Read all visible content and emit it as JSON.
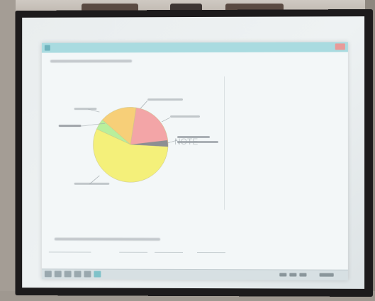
{
  "scene": {
    "description_tags": [
      "projector-screen",
      "slide-display"
    ]
  },
  "screen": {
    "window": {
      "title": "",
      "close_label": ""
    },
    "chart": {
      "type": "pie",
      "segments": [
        {
          "name": "yellow",
          "color": "#f4f07a"
        },
        {
          "name": "green",
          "color": "#b8ef9c"
        },
        {
          "name": "orange",
          "color": "#f7cf78"
        },
        {
          "name": "pink",
          "color": "#f3a5a7"
        }
      ],
      "center_text": "NOTE"
    }
  }
}
